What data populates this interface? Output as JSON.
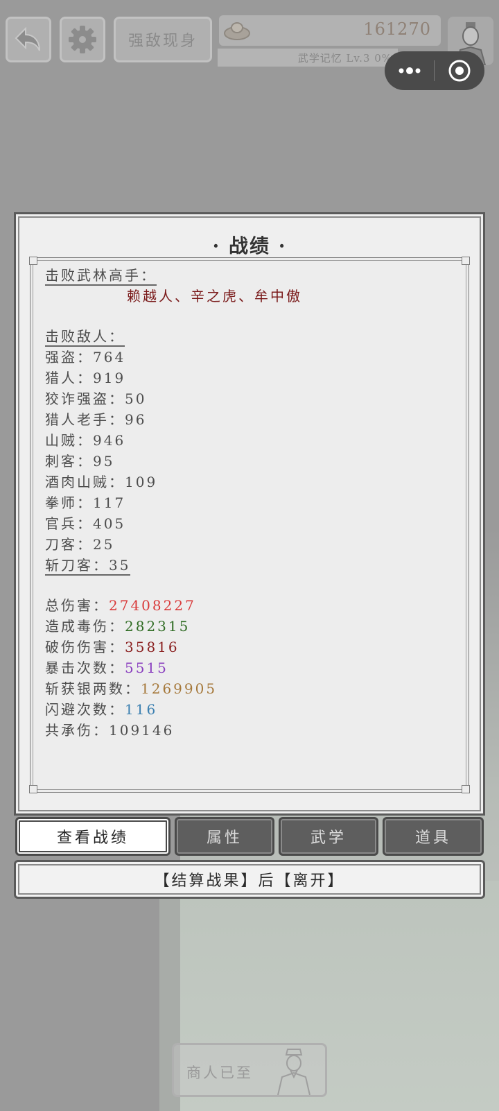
{
  "topbar": {
    "title": "强敌现身",
    "silver_count": "161270",
    "xp_label": "武学记忆 Lv.3 0%"
  },
  "panel": {
    "title": "· 战绩 ·",
    "masters_heading": "击败武林高手：",
    "masters_list": "赖越人、辛之虎、牟中傲",
    "enemies_heading": "击败敌人：",
    "enemies": [
      {
        "name": "强盗",
        "count": "764"
      },
      {
        "name": "猎人",
        "count": "919"
      },
      {
        "name": "狡诈强盗",
        "count": "50"
      },
      {
        "name": "猎人老手",
        "count": "96"
      },
      {
        "name": "山贼",
        "count": "946"
      },
      {
        "name": "刺客",
        "count": "95"
      },
      {
        "name": "酒肉山贼",
        "count": "109"
      },
      {
        "name": "拳师",
        "count": "117"
      },
      {
        "name": "官兵",
        "count": "405"
      },
      {
        "name": "刀客",
        "count": "25"
      },
      {
        "name": "斩刀客",
        "count": "35"
      }
    ],
    "stats": [
      {
        "label": "总伤害",
        "value": "27408227",
        "color": "#d93a3a"
      },
      {
        "label": "造成毒伤",
        "value": "282315",
        "color": "#2e6b22"
      },
      {
        "label": "破伤伤害",
        "value": "35816",
        "color": "#8a1f1f"
      },
      {
        "label": "暴击次数",
        "value": "5515",
        "color": "#8a3fbf"
      },
      {
        "label": "斩获银两数",
        "value": "1269905",
        "color": "#a5783a"
      },
      {
        "label": "闪避次数",
        "value": "116",
        "color": "#3a7fb0"
      },
      {
        "label": "共承伤",
        "value": "109146",
        "color": "#4d4d4d"
      }
    ],
    "separator": "："
  },
  "tabs": [
    {
      "label": "查看战绩",
      "active": true
    },
    {
      "label": "属性",
      "active": false
    },
    {
      "label": "武学",
      "active": false
    },
    {
      "label": "道具",
      "active": false
    }
  ],
  "settle_button": "【结算战果】后【离开】",
  "merchant_label": "商人已至",
  "icons": [
    "back-arrow-icon",
    "gear-icon",
    "silver-ingot-icon",
    "hero-avatar-icon",
    "more-dots-icon",
    "target-circle-icon",
    "merchant-portrait-icon"
  ]
}
